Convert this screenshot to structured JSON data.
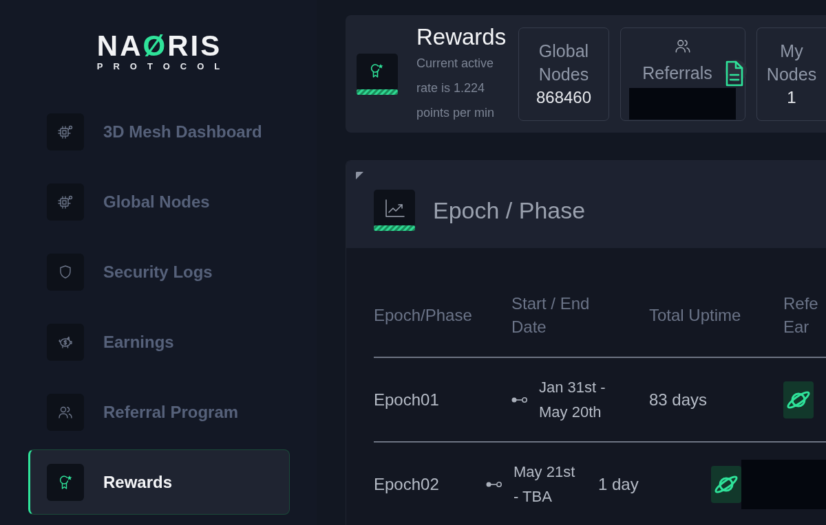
{
  "logo": {
    "before": "NA",
    "accent": "Ø",
    "after": "RIS",
    "tagline": "PROTOCOL"
  },
  "sidebar": {
    "items": [
      {
        "label": "3D Mesh Dashboard",
        "selected": false
      },
      {
        "label": "Global Nodes",
        "selected": false
      },
      {
        "label": "Security Logs",
        "selected": false
      },
      {
        "label": "Earnings",
        "selected": false
      },
      {
        "label": "Referral Program",
        "selected": false
      },
      {
        "label": "Rewards",
        "selected": true
      }
    ]
  },
  "header": {
    "title": "Rewards",
    "description": "Current active\nrate is 1.224\npoints per min",
    "stats": [
      {
        "kind": "count",
        "label": "Global\nNodes",
        "value": "868460"
      },
      {
        "kind": "referral",
        "label": "Referrals"
      },
      {
        "kind": "count",
        "label": "My\nNodes",
        "value": "1"
      }
    ]
  },
  "epochs": {
    "title": "Epoch / Phase",
    "table": {
      "columns": [
        "Epoch/Phase",
        "Start / End\nDate",
        "Total Uptime",
        "Refe\nEar"
      ],
      "rows": [
        {
          "epoch": "Epoch01",
          "dates": "Jan 31st -\nMay 20th",
          "uptime": "83 days",
          "redacted": false
        },
        {
          "epoch": "Epoch02",
          "dates": "May 21st\n- TBA",
          "uptime": "1 day",
          "redacted": true
        }
      ]
    }
  }
}
